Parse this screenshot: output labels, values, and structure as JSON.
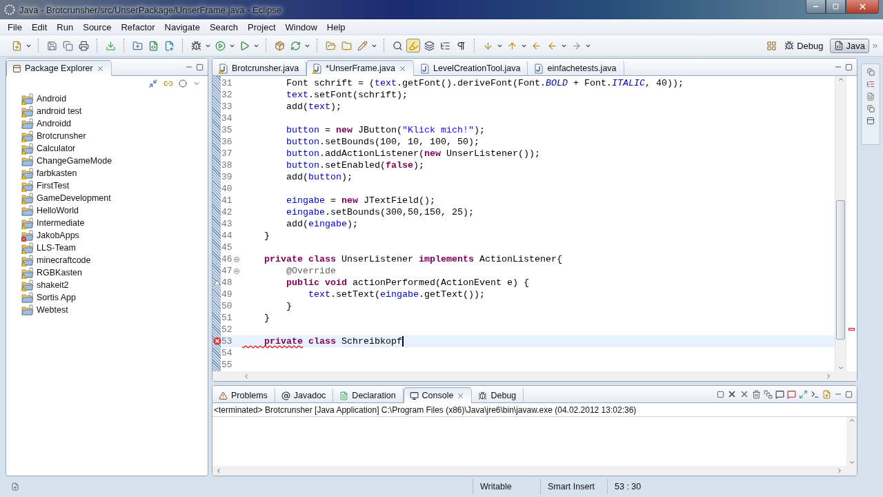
{
  "window": {
    "title": "Java - Brotcrunsher/src/UnserPackage/UnserFrame.java - Eclipse"
  },
  "menu": [
    "File",
    "Edit",
    "Run",
    "Source",
    "Refactor",
    "Navigate",
    "Search",
    "Project",
    "Window",
    "Help"
  ],
  "perspectives": [
    {
      "label": "Debug",
      "selected": false
    },
    {
      "label": "Java",
      "selected": true
    }
  ],
  "package_explorer": {
    "title": "Package Explorer",
    "projects": [
      {
        "name": "Android",
        "warning": true,
        "error": false
      },
      {
        "name": "android test",
        "warning": true,
        "error": false
      },
      {
        "name": "Androidd",
        "warning": false,
        "error": false
      },
      {
        "name": "Brotcrunsher",
        "warning": true,
        "error": false
      },
      {
        "name": "Calculator",
        "warning": true,
        "error": false
      },
      {
        "name": "ChangeGameMode",
        "warning": false,
        "error": false
      },
      {
        "name": "farbkasten",
        "warning": true,
        "error": false
      },
      {
        "name": "FirstTest",
        "warning": true,
        "error": false
      },
      {
        "name": "GameDevelopment",
        "warning": true,
        "error": false
      },
      {
        "name": "HelloWorld",
        "warning": false,
        "error": false
      },
      {
        "name": "Intermediate",
        "warning": true,
        "error": false
      },
      {
        "name": "JakobApps",
        "warning": false,
        "error": true
      },
      {
        "name": "LLS-Team",
        "warning": true,
        "error": false
      },
      {
        "name": "minecraftcode",
        "warning": true,
        "error": false
      },
      {
        "name": "RGBKasten",
        "warning": true,
        "error": false
      },
      {
        "name": "shakeit2",
        "warning": true,
        "error": false
      },
      {
        "name": "Sortis App",
        "warning": false,
        "error": false
      },
      {
        "name": "Webtest",
        "warning": false,
        "error": false
      }
    ]
  },
  "editor": {
    "tabs": [
      {
        "label": "Brotcrunsher.java",
        "selected": false,
        "warning": true
      },
      {
        "label": "*UnserFrame.java",
        "selected": true,
        "warning": true
      },
      {
        "label": "LevelCreationTool.java",
        "selected": false,
        "warning": false
      },
      {
        "label": "einfachetests.java",
        "selected": false,
        "warning": false
      }
    ],
    "lines": [
      {
        "number": "31",
        "current": false,
        "kind": "plain",
        "segments": [
          {
            "kind": "plain",
            "text": "        Font schrift = ("
          },
          {
            "kind": "field",
            "text": "text"
          },
          {
            "kind": "plain",
            "text": ".getFont().deriveFont(Font."
          },
          {
            "kind": "static",
            "text": "BOLD"
          },
          {
            "kind": "plain",
            "text": " + Font."
          },
          {
            "kind": "static",
            "text": "ITALIC"
          },
          {
            "kind": "plain",
            "text": ", 40));"
          }
        ]
      },
      {
        "number": "32",
        "current": false,
        "kind": "plain",
        "segments": [
          {
            "kind": "field",
            "text": "        text"
          },
          {
            "kind": "plain",
            "text": ".setFont(schrift);"
          }
        ]
      },
      {
        "number": "33",
        "current": false,
        "kind": "plain",
        "segments": [
          {
            "kind": "plain",
            "text": "        add("
          },
          {
            "kind": "field",
            "text": "text"
          },
          {
            "kind": "plain",
            "text": ");"
          }
        ]
      },
      {
        "number": "34",
        "current": false,
        "kind": "plain"
      },
      {
        "number": "35",
        "current": false,
        "kind": "plain",
        "segments": [
          {
            "kind": "field",
            "text": "        button"
          },
          {
            "kind": "plain",
            "text": " = "
          },
          {
            "kind": "kw",
            "text": "new"
          },
          {
            "kind": "plain",
            "text": " JButton("
          },
          {
            "kind": "string",
            "text": "\"Klick mich!\""
          },
          {
            "kind": "plain",
            "text": ");"
          }
        ]
      },
      {
        "number": "36",
        "current": false,
        "kind": "plain",
        "segments": [
          {
            "kind": "field",
            "text": "        button"
          },
          {
            "kind": "plain",
            "text": ".setBounds(100, 10, 100, 50);"
          }
        ]
      },
      {
        "number": "37",
        "current": false,
        "kind": "plain",
        "segments": [
          {
            "kind": "field",
            "text": "        button"
          },
          {
            "kind": "plain",
            "text": ".addActionListener("
          },
          {
            "kind": "kw",
            "text": "new"
          },
          {
            "kind": "plain",
            "text": " UnserListener());"
          }
        ]
      },
      {
        "number": "38",
        "current": false,
        "kind": "plain",
        "segments": [
          {
            "kind": "field",
            "text": "        button"
          },
          {
            "kind": "plain",
            "text": ".setEnabled("
          },
          {
            "kind": "kw",
            "text": "false"
          },
          {
            "kind": "plain",
            "text": ");"
          }
        ]
      },
      {
        "number": "39",
        "current": false,
        "kind": "plain",
        "segments": [
          {
            "kind": "plain",
            "text": "        add("
          },
          {
            "kind": "field",
            "text": "button"
          },
          {
            "kind": "plain",
            "text": ");"
          }
        ]
      },
      {
        "number": "40",
        "current": false,
        "kind": "plain"
      },
      {
        "number": "41",
        "current": false,
        "kind": "plain",
        "segments": [
          {
            "kind": "field",
            "text": "        eingabe"
          },
          {
            "kind": "plain",
            "text": " = "
          },
          {
            "kind": "kw",
            "text": "new"
          },
          {
            "kind": "plain",
            "text": " JTextField();"
          }
        ]
      },
      {
        "number": "42",
        "current": false,
        "kind": "plain",
        "segments": [
          {
            "kind": "field",
            "text": "        eingabe"
          },
          {
            "kind": "plain",
            "text": ".setBounds(300,50,150, 25);"
          }
        ]
      },
      {
        "number": "43",
        "current": false,
        "kind": "plain",
        "segments": [
          {
            "kind": "plain",
            "text": "        add("
          },
          {
            "kind": "field",
            "text": "eingabe"
          },
          {
            "kind": "plain",
            "text": ");"
          }
        ]
      },
      {
        "number": "44",
        "current": false,
        "kind": "plain",
        "segments": [
          {
            "kind": "plain",
            "text": "    }"
          }
        ]
      },
      {
        "number": "45",
        "current": false,
        "kind": "plain"
      },
      {
        "number": "46",
        "current": false,
        "kind": "fold",
        "segments": [
          {
            "kind": "kw",
            "text": "    private"
          },
          {
            "kind": "kw",
            "text": " class"
          },
          {
            "kind": "plain",
            "text": " UnserListener "
          },
          {
            "kind": "kw",
            "text": "implements"
          },
          {
            "kind": "plain",
            "text": " ActionListener{"
          }
        ]
      },
      {
        "number": "47",
        "current": false,
        "kind": "fold",
        "segments": [
          {
            "kind": "annotation",
            "text": "        @Override"
          }
        ]
      },
      {
        "number": "48",
        "current": false,
        "kind": "override",
        "segments": [
          {
            "kind": "kw",
            "text": "        public"
          },
          {
            "kind": "kw",
            "text": " void"
          },
          {
            "kind": "plain",
            "text": " actionPerformed(ActionEvent e) {"
          }
        ]
      },
      {
        "number": "49",
        "current": false,
        "kind": "plain",
        "segments": [
          {
            "kind": "field",
            "text": "            text"
          },
          {
            "kind": "plain",
            "text": ".setText("
          },
          {
            "kind": "field",
            "text": "eingabe"
          },
          {
            "kind": "plain",
            "text": ".getText());"
          }
        ]
      },
      {
        "number": "50",
        "current": false,
        "kind": "plain",
        "segments": [
          {
            "kind": "plain",
            "text": "        }"
          }
        ]
      },
      {
        "number": "51",
        "current": false,
        "kind": "plain",
        "segments": [
          {
            "kind": "plain",
            "text": "    }"
          }
        ]
      },
      {
        "number": "52",
        "current": false,
        "kind": "plain"
      },
      {
        "number": "53",
        "current": true,
        "kind": "error",
        "segments": [
          {
            "kind": "kw_error",
            "text": "    private"
          },
          {
            "kind": "kw",
            "text": " class"
          },
          {
            "kind": "plain",
            "text": " Schreibkopf"
          }
        ]
      },
      {
        "number": "54",
        "current": false,
        "kind": "plain"
      },
      {
        "number": "55",
        "current": false,
        "kind": "plain"
      }
    ]
  },
  "bottom_panel": {
    "tabs": [
      {
        "label": "Problems",
        "selected": false,
        "kind": "problems"
      },
      {
        "label": "Javadoc",
        "selected": false,
        "kind": "javadoc"
      },
      {
        "label": "Declaration",
        "selected": false,
        "kind": "declaration"
      },
      {
        "label": "Console",
        "selected": true,
        "kind": "console"
      },
      {
        "label": "Debug",
        "selected": false,
        "kind": "debug"
      }
    ],
    "console_header": "<terminated> Brotcrunsher [Java Application] C:\\Program Files (x86)\\Java\\jre6\\bin\\javaw.exe (04.02.2012 13:02:36)"
  },
  "status_bar": {
    "mode": "Writable",
    "insert_mode": "Smart Insert",
    "position": "53 : 30"
  }
}
